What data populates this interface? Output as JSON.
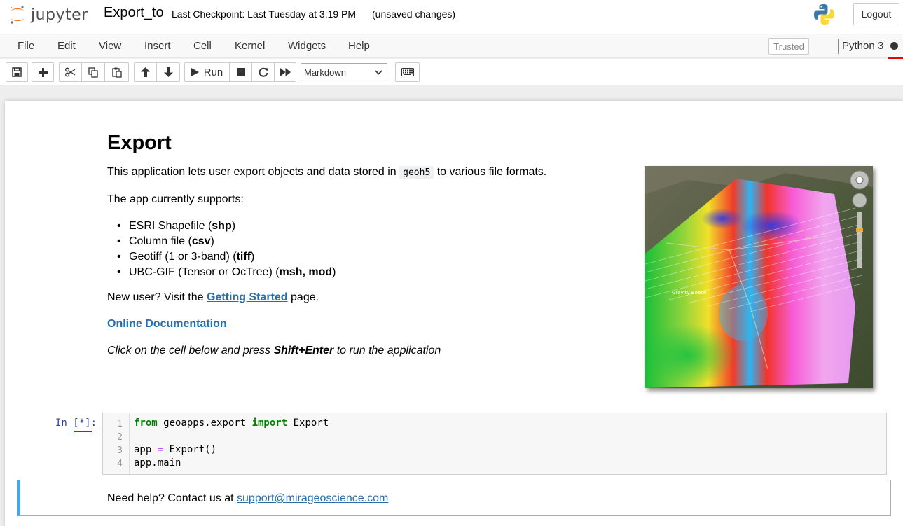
{
  "header": {
    "logo_text": "jupyter",
    "notebook_name": "Export_to",
    "checkpoint": "Last Checkpoint: Last Tuesday at 3:19 PM",
    "autosave": "(unsaved changes)",
    "logout_label": "Logout"
  },
  "menubar": {
    "items": [
      "File",
      "Edit",
      "View",
      "Insert",
      "Cell",
      "Kernel",
      "Widgets",
      "Help"
    ],
    "trusted_label": "Trusted",
    "kernel_name": "Python 3"
  },
  "toolbar": {
    "run_label": "Run",
    "cell_type": "Markdown"
  },
  "markdown_cell": {
    "title": "Export",
    "intro_before": "This application lets user export objects and data stored in",
    "intro_code": "geoh5",
    "intro_after": "to various file formats.",
    "supports": "The app currently supports:",
    "formats": [
      {
        "text": "ESRI Shapefile (",
        "bold": "shp",
        "end": ")"
      },
      {
        "text": "Column file (",
        "bold": "csv",
        "end": ")"
      },
      {
        "text": "Geotiff (1 or 3-band) (",
        "bold": "tiff",
        "end": ")"
      },
      {
        "text": "UBC-GIF (Tensor or OcTree) (",
        "bold": "msh, mod",
        "end": ")"
      }
    ],
    "new_user_before": "New user? Visit the",
    "getting_started_link": "Getting Started",
    "new_user_after": "page.",
    "docs_link": "Online Documentation",
    "instruction_before": "Click on the cell below and press",
    "instruction_key": "Shift+Enter",
    "instruction_after": "to run the application",
    "image_label": "Gravity Beach"
  },
  "code_cell": {
    "prompt": "In [*]:",
    "line_numbers": [
      "1",
      "2",
      "3",
      "4"
    ],
    "lines": [
      [
        {
          "t": "from",
          "c": "kw"
        },
        {
          "t": " geoapps.export ",
          "c": ""
        },
        {
          "t": "import",
          "c": "kw"
        },
        {
          "t": " Export",
          "c": ""
        }
      ],
      [],
      [
        {
          "t": "app ",
          "c": ""
        },
        {
          "t": "=",
          "c": "op"
        },
        {
          "t": " Export()",
          "c": ""
        }
      ],
      [
        {
          "t": "app.main",
          "c": ""
        }
      ]
    ]
  },
  "help_cell": {
    "text": "Need help? Contact us at",
    "email": "support@mirageoscience.com"
  }
}
